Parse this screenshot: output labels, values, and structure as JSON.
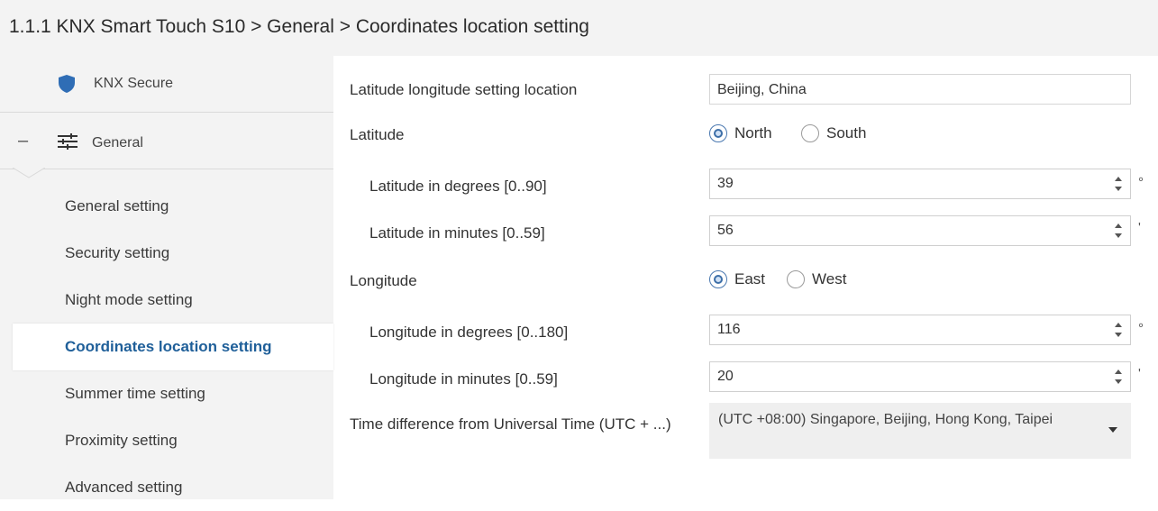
{
  "header": {
    "breadcrumb": "1.1.1 KNX Smart Touch S10 > General > Coordinates location setting"
  },
  "sidebar": {
    "secure_label": "KNX Secure",
    "general_label": "General",
    "collapse_symbol": "–",
    "items": [
      {
        "label": "General setting"
      },
      {
        "label": "Security setting"
      },
      {
        "label": "Night mode setting"
      },
      {
        "label": "Coordinates location setting"
      },
      {
        "label": "Summer time setting"
      },
      {
        "label": "Proximity setting"
      },
      {
        "label": "Advanced setting"
      }
    ],
    "active_index": 3
  },
  "form": {
    "location": {
      "label": "Latitude longitude setting location",
      "value": "Beijing, China"
    },
    "latitude": {
      "label": "Latitude",
      "options": [
        "North",
        "South"
      ],
      "selected": "North"
    },
    "lat_degrees": {
      "label": "Latitude in degrees [0..90]",
      "value": "39",
      "unit": "°"
    },
    "lat_minutes": {
      "label": "Latitude in minutes [0..59]",
      "value": "56",
      "unit": "'"
    },
    "longitude": {
      "label": "Longitude",
      "options": [
        "East",
        "West"
      ],
      "selected": "East"
    },
    "lon_degrees": {
      "label": "Longitude in degrees [0..180]",
      "value": "116",
      "unit": "°"
    },
    "lon_minutes": {
      "label": "Longitude in minutes [0..59]",
      "value": "20",
      "unit": "'"
    },
    "utc": {
      "label": "Time difference from Universal Time (UTC + ...)",
      "value": "(UTC +08:00) Singapore,  Beijing, Hong Kong, Taipei"
    }
  },
  "colors": {
    "accent": "#1f5f99",
    "sidebar_bg": "#f3f3f3",
    "shield": "#2f6db5"
  }
}
